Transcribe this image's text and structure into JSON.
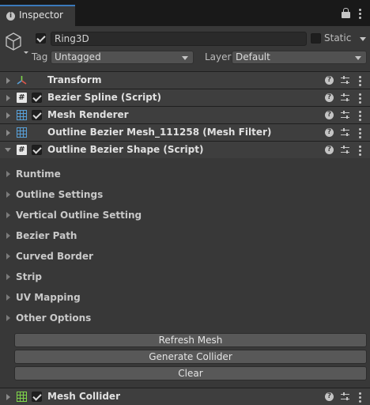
{
  "tab": {
    "title": "Inspector",
    "icon": "info-icon"
  },
  "header": {
    "active": true,
    "object_name": "Ring3D",
    "static_label": "Static",
    "static_checked": false,
    "tag_label": "Tag",
    "tag_value": "Untagged",
    "layer_label": "Layer",
    "layer_value": "Default"
  },
  "components": [
    {
      "name": "Transform",
      "icon": "transform-axes-icon",
      "has_checkbox": false,
      "expanded": false
    },
    {
      "name": "Bezier Spline (Script)",
      "icon": "script-icon",
      "has_checkbox": true,
      "enabled": true,
      "expanded": false
    },
    {
      "name": "Mesh Renderer",
      "icon": "mesh-renderer-icon",
      "has_checkbox": true,
      "enabled": true,
      "expanded": false
    },
    {
      "name": "Outline Bezier Mesh_111258 (Mesh Filter)",
      "icon": "mesh-filter-icon",
      "has_checkbox": false,
      "expanded": false
    },
    {
      "name": "Outline Bezier Shape (Script)",
      "icon": "script-icon",
      "has_checkbox": true,
      "enabled": true,
      "expanded": true
    }
  ],
  "sections": [
    "Runtime",
    "Outline Settings",
    "Vertical Outline Setting",
    "Bezier Path",
    "Curved Border",
    "Strip",
    "UV Mapping",
    "Other Options"
  ],
  "buttons": {
    "refresh_mesh": "Refresh Mesh",
    "generate_collider": "Generate Collider",
    "clear": "Clear"
  },
  "last_component": {
    "name": "Mesh Collider",
    "icon": "mesh-collider-icon",
    "has_checkbox": true,
    "enabled": true,
    "expanded": false
  },
  "icons": {
    "script_glyph": "#",
    "help_glyph": "?",
    "info_glyph": "i"
  },
  "colors": {
    "accent": "#3a79bb",
    "panel": "#383838",
    "component_header": "#3e3e3e"
  }
}
